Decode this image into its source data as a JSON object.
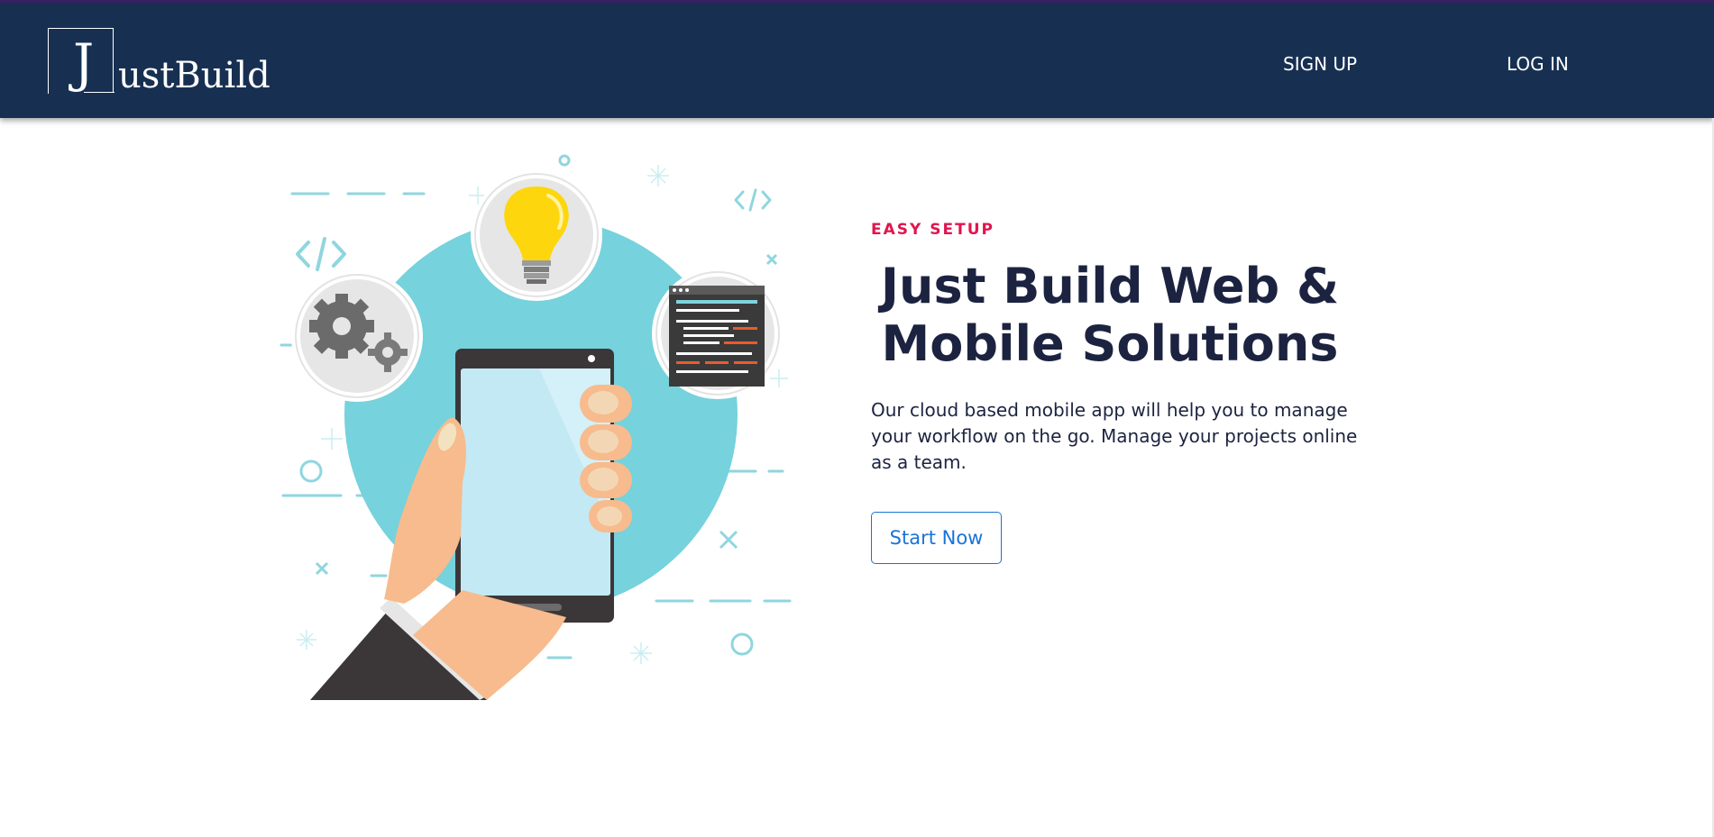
{
  "brand": {
    "logo_initial": "J",
    "logo_rest": "ustBuild"
  },
  "nav": {
    "signup_label": "SIGN UP",
    "login_label": "LOG IN"
  },
  "hero": {
    "eyebrow": "EASY SETUP",
    "headline": "Just Build Web & Mobile Solutions",
    "description": "Our cloud based mobile app will help you to manage your workflow on the go. Manage your projects online as a team.",
    "cta_label": "Start Now"
  },
  "colors": {
    "header_bg": "#173052",
    "accent_pink": "#e0154e",
    "headline_text": "#1c2340",
    "button_blue": "#1a73d9",
    "illustration_teal": "#76d2dc"
  },
  "icons": [
    "lightbulb-icon",
    "gears-icon",
    "code-window-icon",
    "smartphone-in-hand-icon"
  ]
}
